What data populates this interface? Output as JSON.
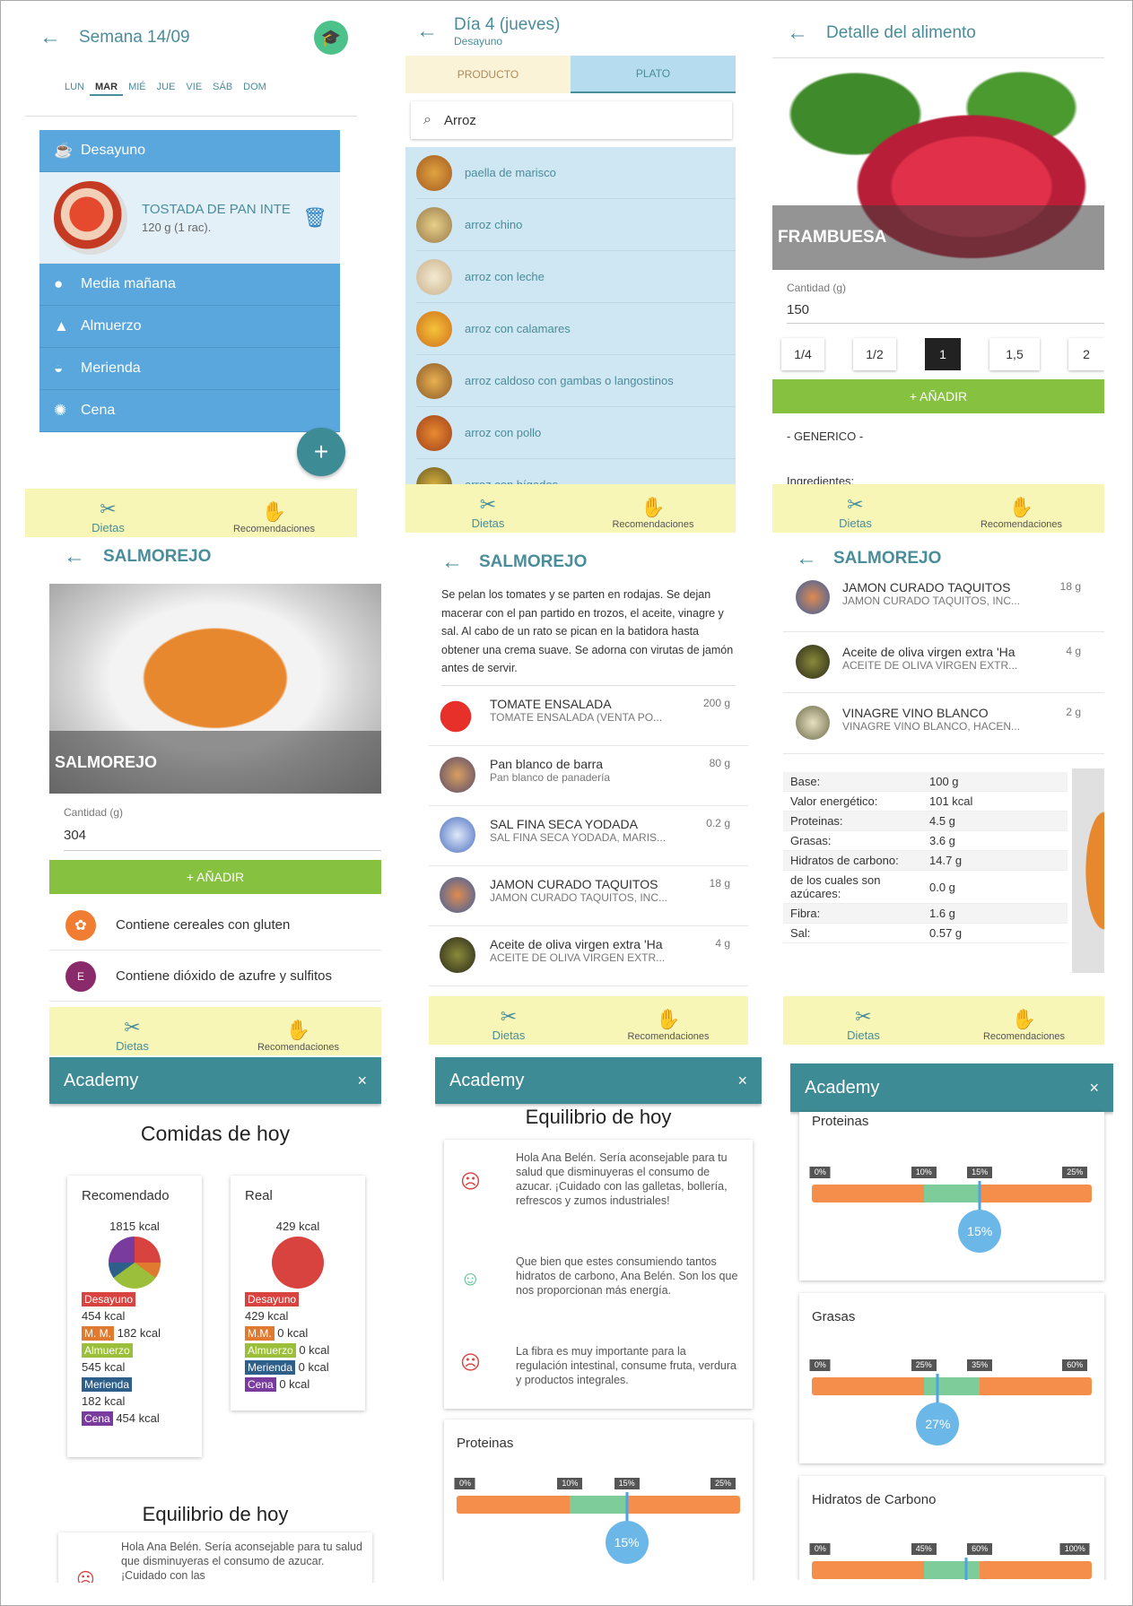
{
  "p1": {
    "title": "Semana 14/09",
    "days": [
      "LUN",
      "MAR",
      "MIÉ",
      "JUE",
      "VIE",
      "SÁB",
      "DOM"
    ],
    "meals": [
      "Desayuno",
      "Media mañana",
      "Almuerzo",
      "Merienda",
      "Cena"
    ],
    "item_name": "TOSTADA DE PAN INTE",
    "item_qty": "120 g (1 rac).",
    "fab": "+"
  },
  "nav": {
    "dietas": "Dietas",
    "rec": "Recomendaciones"
  },
  "p2": {
    "title": "Día 4 (jueves)",
    "subtitle": "Desayuno",
    "tab1": "PRODUCTO",
    "tab2": "PLATO",
    "search": "Arroz",
    "items": [
      "paella de marisco",
      "arroz chino",
      "arroz con leche",
      "arroz con calamares",
      "arroz caldoso con gambas o langostinos",
      "arroz con pollo",
      "arroz con hígados"
    ]
  },
  "p3": {
    "title": "Detalle del alimento",
    "food": "FRAMBUESA",
    "qty_label": "Cantidad (g)",
    "qty": "150",
    "portions": [
      "1/4",
      "1/2",
      "1",
      "1,5",
      "2"
    ],
    "add": "+ AÑADIR",
    "generic": "- GENERICO -",
    "ingredients": "Ingredientes:"
  },
  "p4": {
    "title": "SALMOREJO",
    "food": "SALMOREJO",
    "qty_label": "Cantidad (g)",
    "qty": "304",
    "add": "+ AÑADIR",
    "allergens": [
      "Contiene cereales con gluten",
      "Contiene dióxido de azufre y sulfitos"
    ]
  },
  "p5": {
    "title": "SALMOREJO",
    "recipe": "Se pelan los tomates y se parten en rodajas. Se dejan macerar con el pan partido en trozos, el aceite, vinagre y sal. Al cabo de un rato se pican en la batidora hasta obtener una crema suave. Se adorna con virutas de jamón antes de servir.",
    "ingredients": [
      {
        "name": "TOMATE ENSALADA",
        "desc": "TOMATE ENSALADA (VENTA PO...",
        "qty": "200 g"
      },
      {
        "name": "Pan blanco de barra",
        "desc": "Pan blanco de panadería",
        "qty": "80 g"
      },
      {
        "name": "SAL FINA SECA YODADA",
        "desc": "SAL FINA SECA YODADA, MARIS...",
        "qty": "0.2 g"
      },
      {
        "name": "JAMON CURADO TAQUITOS",
        "desc": "JAMON CURADO TAQUITOS, INC...",
        "qty": "18 g"
      },
      {
        "name": "Aceite de oliva virgen extra 'Ha",
        "desc": "ACEITE DE OLIVA VIRGEN EXTR...",
        "qty": "4 g"
      }
    ]
  },
  "p6": {
    "title": "SALMOREJO",
    "ingredients": [
      {
        "name": "JAMON CURADO TAQUITOS",
        "desc": "JAMON CURADO TAQUITOS, INC...",
        "qty": "18 g"
      },
      {
        "name": "Aceite de oliva virgen extra 'Ha",
        "desc": "ACEITE DE OLIVA VIRGEN EXTR...",
        "qty": "4 g"
      },
      {
        "name": "VINAGRE VINO BLANCO",
        "desc": "VINAGRE VINO BLANCO, HACEN...",
        "qty": "2 g"
      }
    ],
    "nutrition": [
      [
        "Base:",
        "100 g"
      ],
      [
        "Valor energético:",
        "101 kcal"
      ],
      [
        "Proteinas:",
        "4.5 g"
      ],
      [
        "Grasas:",
        "3.6 g"
      ],
      [
        "Hidratos de carbono:",
        "14.7 g"
      ],
      [
        "de los cuales son azúcares:",
        "0.0 g"
      ],
      [
        "Fibra:",
        "1.6 g"
      ],
      [
        "Sal:",
        "0.57 g"
      ]
    ]
  },
  "p7": {
    "academy": "Academy",
    "close": "×",
    "heading": "Comidas de hoy",
    "rec": {
      "label": "Recomendado",
      "kcal": "1815 kcal",
      "lines": [
        {
          "tag": "Desayuno",
          "color": "#d9433f",
          "val": "454 kcal"
        },
        {
          "tag": "M. M.",
          "color": "#e07a2e",
          "val": "182 kcal"
        },
        {
          "tag": "Almuerzo",
          "color": "#9bbf3a",
          "val": "545 kcal"
        },
        {
          "tag": "Merienda",
          "color": "#2d5f8a",
          "val": "182 kcal"
        },
        {
          "tag": "Cena",
          "color": "#7a3b9e",
          "val": "454 kcal"
        }
      ]
    },
    "real": {
      "label": "Real",
      "kcal": "429 kcal",
      "lines": [
        {
          "tag": "Desayuno",
          "color": "#d9433f",
          "val": "429 kcal"
        },
        {
          "tag": "M.M.",
          "color": "#e07a2e",
          "val": "0 kcal"
        },
        {
          "tag": "Almuerzo",
          "color": "#9bbf3a",
          "val": "0 kcal"
        },
        {
          "tag": "Merienda",
          "color": "#2d5f8a",
          "val": "0 kcal"
        },
        {
          "tag": "Cena",
          "color": "#7a3b9e",
          "val": "0 kcal"
        }
      ]
    },
    "heading2": "Equilibrio de hoy",
    "tip": "Hola Ana Belén. Sería aconsejable para tu salud que disminuyeras el consumo de azucar. ¡Cuidado con las"
  },
  "p8": {
    "academy": "Academy",
    "close": "×",
    "heading": "Equilibrio de hoy",
    "tips": [
      "Hola Ana Belén. Sería aconsejable para tu salud que disminuyeras el consumo de azucar. ¡Cuidado con las galletas, bollería, refrescos y zumos industriales!",
      "Que bien que estes consumiendo tantos hidratos de carbono, Ana Belén. Son los que nos proporcionan más energía.",
      "La fibra es muy importante para la regulación intestinal, consume fruta, verdura y productos integrales."
    ],
    "bar": {
      "label": "Proteinas",
      "ticks": [
        "0%",
        "10%",
        "15%",
        "25%"
      ],
      "value": "15%",
      "value_frac": 0.6
    }
  },
  "p9": {
    "academy": "Academy",
    "close": "×",
    "bars": [
      {
        "label": "Proteinas",
        "ticks": [
          "0%",
          "10%",
          "15%",
          "25%"
        ],
        "value": "15%",
        "value_frac": 0.6
      },
      {
        "label": "Grasas",
        "ticks": [
          "0%",
          "25%",
          "35%",
          "60%"
        ],
        "value": "27%",
        "value_frac": 0.45
      },
      {
        "label": "Hidratos de Carbono",
        "ticks": [
          "0%",
          "45%",
          "60%",
          "100%"
        ],
        "value": "",
        "value_frac": 0.55
      }
    ]
  },
  "colors": {
    "teal": "#4a8d9a",
    "meal_blue": "#5aa7dd",
    "green": "#86c13f",
    "nav_yellow": "#f8f6b6",
    "academy": "#3d8b94",
    "bar_orange": "#f58d4b",
    "bar_green": "#7dcc9a"
  }
}
